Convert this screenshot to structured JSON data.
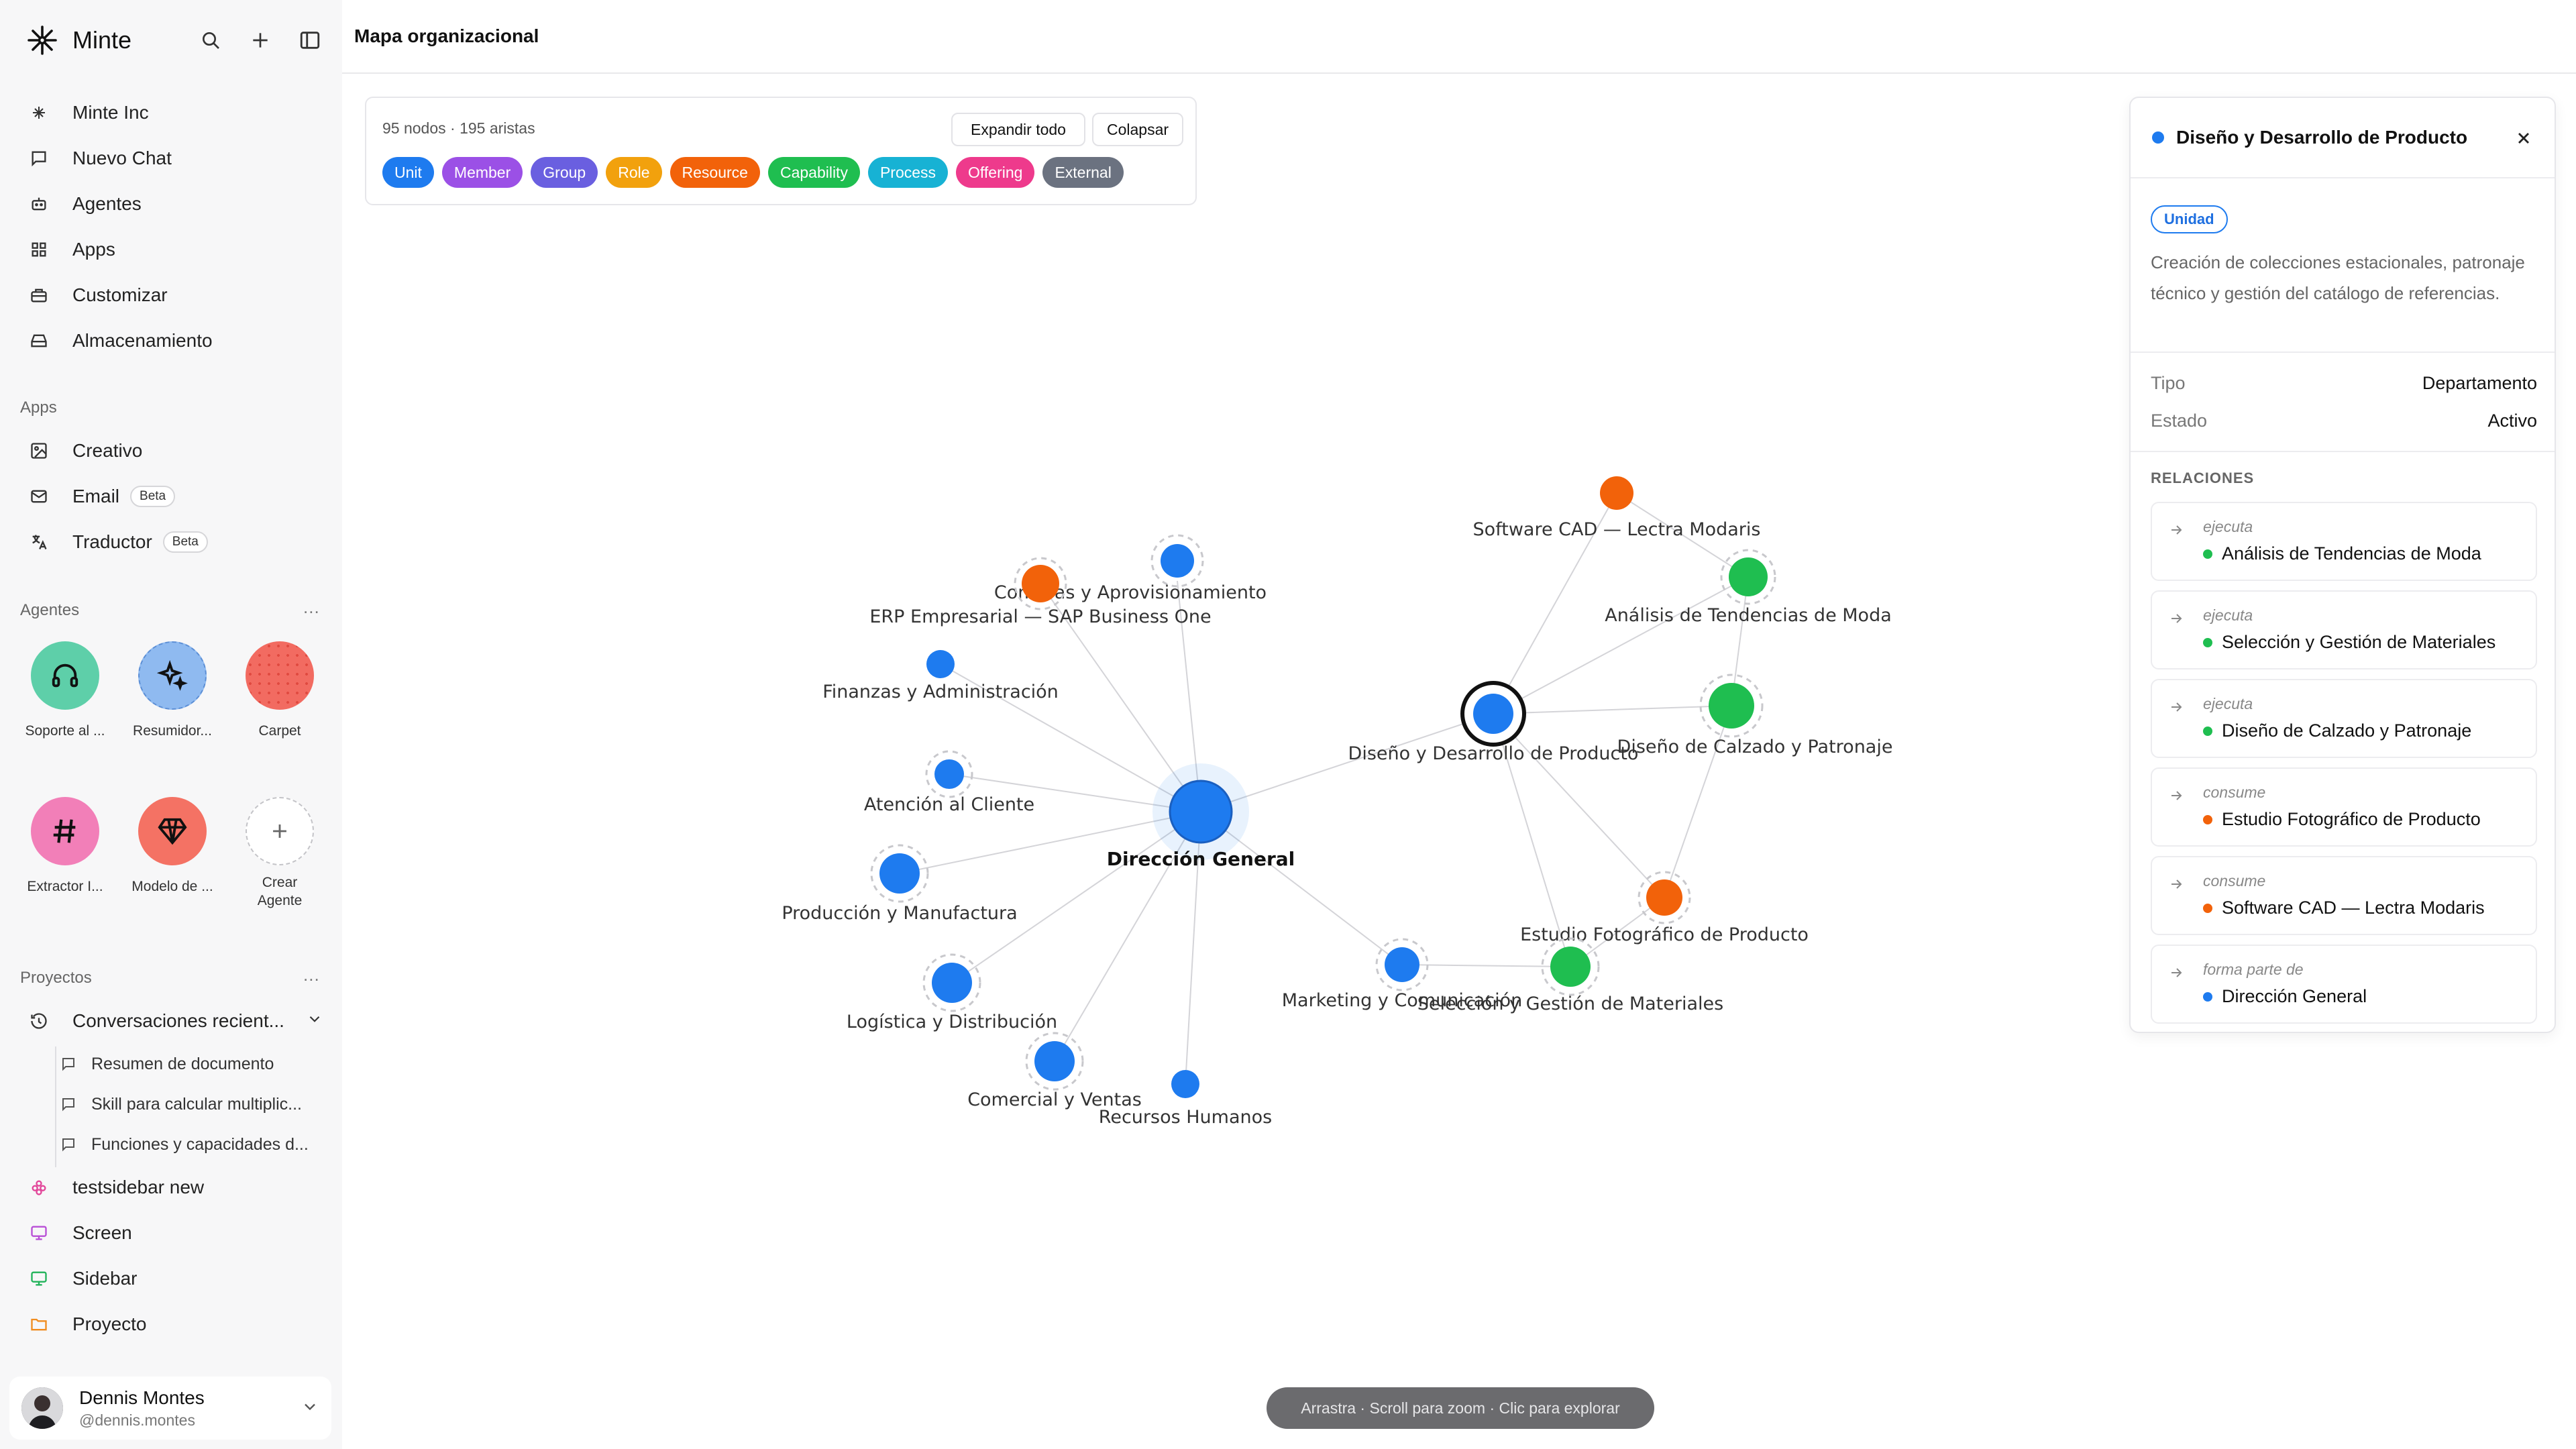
{
  "app": {
    "brand": "Minte"
  },
  "nav": [
    {
      "label": "Minte Inc",
      "icon": "minte-logo-icon"
    },
    {
      "label": "Nuevo Chat",
      "icon": "chat-bubble-icon"
    },
    {
      "label": "Agentes",
      "icon": "robot-icon"
    },
    {
      "label": "Apps",
      "icon": "grid-icon"
    },
    {
      "label": "Customizar",
      "icon": "toolbox-icon"
    },
    {
      "label": "Almacenamiento",
      "icon": "storage-icon"
    }
  ],
  "apps_section": {
    "label": "Apps",
    "items": [
      {
        "label": "Creativo",
        "icon": "image-edit-icon",
        "badge": ""
      },
      {
        "label": "Email",
        "icon": "mail-icon",
        "badge": "Beta"
      },
      {
        "label": "Traductor",
        "icon": "translate-icon",
        "badge": "Beta"
      }
    ]
  },
  "agents_section": {
    "label": "Agentes",
    "more": "...",
    "items": [
      {
        "label": "Soporte al ...",
        "icon": "headphones-icon",
        "color": "#5ecfa9"
      },
      {
        "label": "Resumidor...",
        "icon": "sparkle-icon",
        "color": "#8fbaf0"
      },
      {
        "label": "Carpet",
        "icon": "dots-pattern-icon",
        "color": "#f26b61"
      },
      {
        "label": "Extractor I...",
        "icon": "hash-icon",
        "color": "#f27fb8"
      },
      {
        "label": "Modelo de ...",
        "icon": "gem-icon",
        "color": "#f47264"
      },
      {
        "label": "Crear Agente",
        "icon": "plus-icon",
        "color": "#ffffff"
      }
    ]
  },
  "projects_section": {
    "label": "Proyectos",
    "more": "...",
    "recent": {
      "label": "Conversaciones recient...",
      "icon": "history-icon"
    },
    "recent_items": [
      "Resumen de documento",
      "Skill para calcular multiplic...",
      "Funciones y capacidades d..."
    ],
    "items": [
      {
        "label": "testsidebar new",
        "icon": "flower-icon",
        "color": "#e2479a"
      },
      {
        "label": "Screen",
        "icon": "monitor-icon",
        "color": "#b84fd6"
      },
      {
        "label": "Sidebar",
        "icon": "monitor-icon",
        "color": "#22b35a"
      },
      {
        "label": "Proyecto",
        "icon": "folder-icon",
        "color": "#f08c1f"
      }
    ]
  },
  "user": {
    "name": "Dennis Montes",
    "handle": "@dennis.montes"
  },
  "header": {
    "title": "Mapa organizacional"
  },
  "filters": {
    "stats": "95 nodos · 195 aristas",
    "expand": "Expandir todo",
    "collapse": "Colapsar",
    "chips": [
      {
        "label": "Unit",
        "color": "#1e7bef"
      },
      {
        "label": "Member",
        "color": "#9b50e6"
      },
      {
        "label": "Group",
        "color": "#6a5fe0"
      },
      {
        "label": "Role",
        "color": "#f2a10d"
      },
      {
        "label": "Resource",
        "color": "#f2620a"
      },
      {
        "label": "Capability",
        "color": "#1fbe50"
      },
      {
        "label": "Process",
        "color": "#17b2d4"
      },
      {
        "label": "Offering",
        "color": "#ee3a8c"
      },
      {
        "label": "External",
        "color": "#6b7280"
      }
    ]
  },
  "graph": {
    "colors": {
      "unit": "#1e7bef",
      "resource": "#f2620a",
      "capability": "#1fbe50"
    },
    "nodes": [
      {
        "id": "dg",
        "label": "Dirección General",
        "type": "unit"
      },
      {
        "id": "compras",
        "label": "Compras y Aprovisionamiento",
        "type": "unit"
      },
      {
        "id": "erp",
        "label": "ERP Empresarial — SAP Business One",
        "type": "resource"
      },
      {
        "id": "finanzas",
        "label": "Finanzas y Administración",
        "type": "unit"
      },
      {
        "id": "atencion",
        "label": "Atención al Cliente",
        "type": "unit"
      },
      {
        "id": "produccion",
        "label": "Producción y Manufactura",
        "type": "unit"
      },
      {
        "id": "logistica",
        "label": "Logística y Distribución",
        "type": "unit"
      },
      {
        "id": "comercial",
        "label": "Comercial y Ventas",
        "type": "unit"
      },
      {
        "id": "rrhh",
        "label": "Recursos Humanos",
        "type": "unit"
      },
      {
        "id": "marketing",
        "label": "Marketing y Comunicación",
        "type": "unit"
      },
      {
        "id": "diseno",
        "label": "Diseño y Desarrollo de Producto",
        "type": "unit"
      },
      {
        "id": "software",
        "label": "Software CAD — Lectra Modaris",
        "type": "resource"
      },
      {
        "id": "tendencias",
        "label": "Análisis de Tendencias de Moda",
        "type": "capability"
      },
      {
        "id": "calzado",
        "label": "Diseño de Calzado y Patronaje",
        "type": "capability"
      },
      {
        "id": "estudio",
        "label": "Estudio Fotográfico de Producto",
        "type": "resource"
      },
      {
        "id": "seleccion",
        "label": "Selección y Gestión de Materiales",
        "type": "capability"
      }
    ]
  },
  "hint": "Arrastra · Scroll para zoom · Clic para explorar",
  "panel": {
    "title": "Diseño y Desarrollo de Producto",
    "badge": "Unidad",
    "description": "Creación de colecciones estacionales, patronaje técnico y gestión del catálogo de referencias.",
    "fields": [
      {
        "key": "Tipo",
        "value": "Departamento"
      },
      {
        "key": "Estado",
        "value": "Activo"
      }
    ],
    "relations_label": "RELACIONES",
    "relations": [
      {
        "kind": "ejecuta",
        "target": "Análisis de Tendencias de Moda",
        "color": "#1fbe50"
      },
      {
        "kind": "ejecuta",
        "target": "Selección y Gestión de Materiales",
        "color": "#1fbe50"
      },
      {
        "kind": "ejecuta",
        "target": "Diseño de Calzado y Patronaje",
        "color": "#1fbe50"
      },
      {
        "kind": "consume",
        "target": "Estudio Fotográfico de Producto",
        "color": "#f2620a"
      },
      {
        "kind": "consume",
        "target": "Software CAD — Lectra Modaris",
        "color": "#f2620a"
      },
      {
        "kind": "forma parte de",
        "target": "Dirección General",
        "color": "#1e7bef"
      }
    ]
  }
}
